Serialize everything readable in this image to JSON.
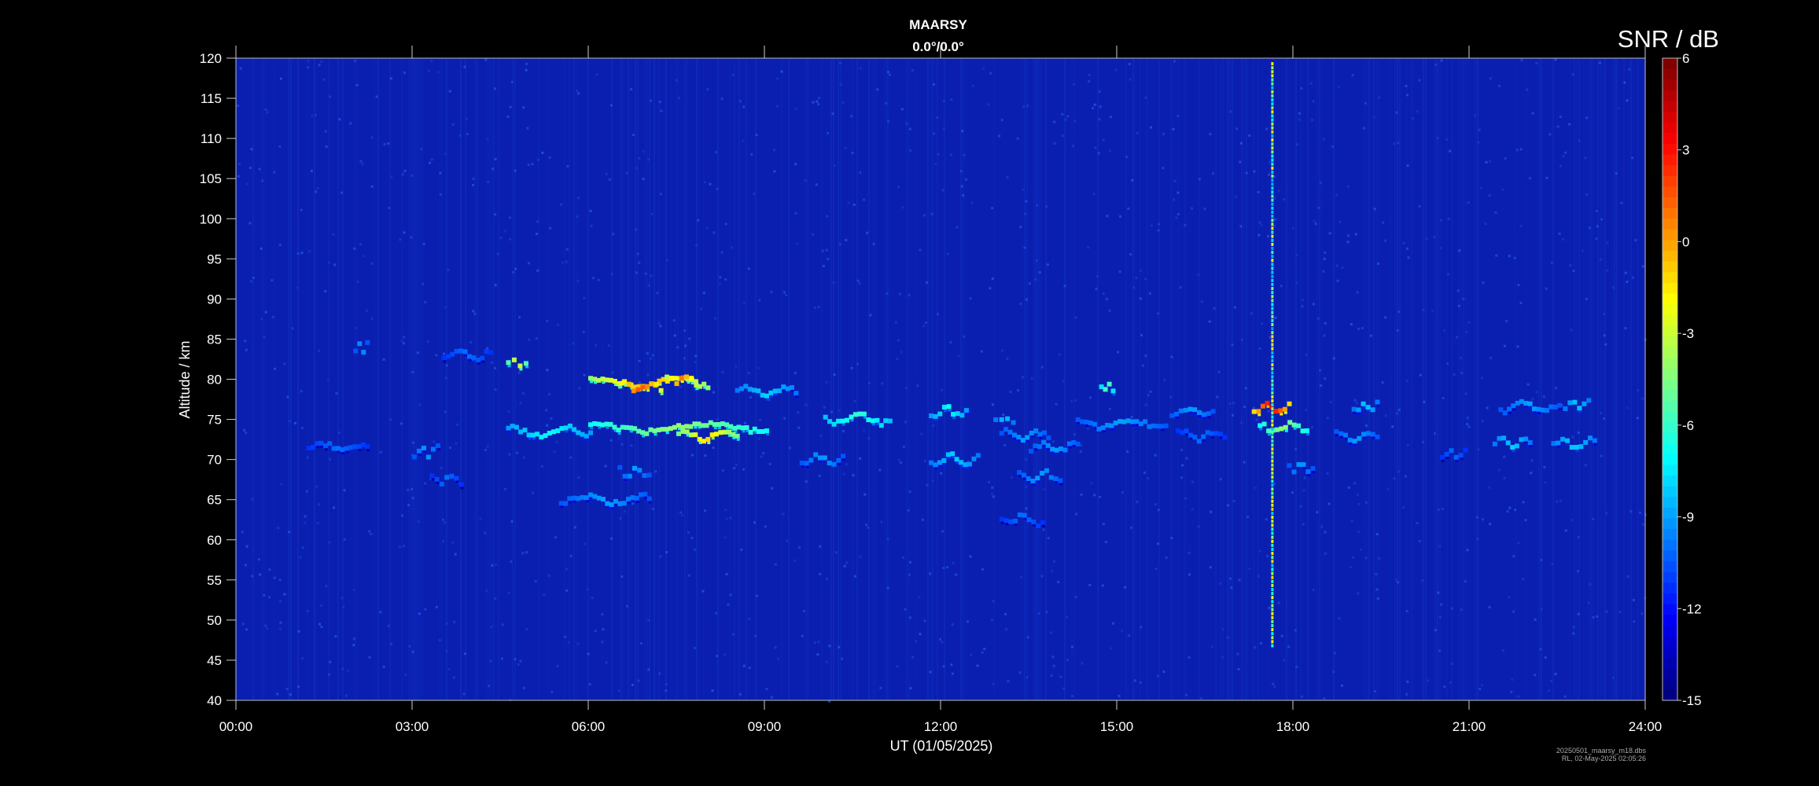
{
  "chart_data": {
    "type": "heatmap",
    "title": "MAARSY",
    "subtitle": "0.0°/0.0°",
    "xlabel": "UT (01/05/2025)",
    "ylabel": "Altitude / km",
    "colorbar_label": "SNR / dB",
    "x_ticks": [
      "00:00",
      "03:00",
      "06:00",
      "09:00",
      "12:00",
      "15:00",
      "18:00",
      "21:00",
      "24:00"
    ],
    "x_range_hours": [
      0,
      24
    ],
    "y_ticks": [
      40,
      45,
      50,
      55,
      60,
      65,
      70,
      75,
      80,
      85,
      90,
      95,
      100,
      105,
      110,
      115,
      120
    ],
    "ylim": [
      40,
      120
    ],
    "colorbar_ticks": [
      6,
      3,
      0,
      -3,
      -6,
      -9,
      -12,
      -15
    ],
    "clim": [
      -15,
      6
    ],
    "colormap": "jet",
    "background_color": "#0a1fb0",
    "features": [
      {
        "t_start": 1.2,
        "t_end": 2.2,
        "alt": 71.5,
        "snr": -10
      },
      {
        "t_start": 3.0,
        "t_end": 3.4,
        "alt": 71,
        "snr": -9
      },
      {
        "t_start": 3.3,
        "t_end": 3.8,
        "alt": 67.5,
        "snr": -10
      },
      {
        "t_start": 2.0,
        "t_end": 2.2,
        "alt": 84,
        "snr": -9
      },
      {
        "t_start": 3.5,
        "t_end": 4.3,
        "alt": 83,
        "snr": -10
      },
      {
        "t_start": 4.6,
        "t_end": 4.9,
        "alt": 82,
        "snr": -2
      },
      {
        "t_start": 4.6,
        "t_end": 6.0,
        "alt": 73.5,
        "snr": -7
      },
      {
        "t_start": 5.5,
        "t_end": 7.0,
        "alt": 65,
        "snr": -9
      },
      {
        "t_start": 6.0,
        "t_end": 8.0,
        "alt": 79.5,
        "snr": 0
      },
      {
        "t_start": 6.5,
        "t_end": 7.2,
        "alt": 79,
        "snr": 2
      },
      {
        "t_start": 7.3,
        "t_end": 7.8,
        "alt": 80,
        "snr": 1
      },
      {
        "t_start": 6.0,
        "t_end": 9.0,
        "alt": 74,
        "snr": -4
      },
      {
        "t_start": 7.5,
        "t_end": 8.5,
        "alt": 73,
        "snr": -1
      },
      {
        "t_start": 6.5,
        "t_end": 7.0,
        "alt": 68.5,
        "snr": -9
      },
      {
        "t_start": 8.5,
        "t_end": 9.5,
        "alt": 78.5,
        "snr": -8
      },
      {
        "t_start": 9.6,
        "t_end": 10.3,
        "alt": 70,
        "snr": -9
      },
      {
        "t_start": 10.0,
        "t_end": 11.1,
        "alt": 75,
        "snr": -6
      },
      {
        "t_start": 11.8,
        "t_end": 12.6,
        "alt": 70,
        "snr": -8
      },
      {
        "t_start": 11.8,
        "t_end": 12.4,
        "alt": 76,
        "snr": -7
      },
      {
        "t_start": 12.9,
        "t_end": 13.2,
        "alt": 75,
        "snr": -8
      },
      {
        "t_start": 13.0,
        "t_end": 13.8,
        "alt": 73,
        "snr": -9
      },
      {
        "t_start": 13.3,
        "t_end": 14.0,
        "alt": 68,
        "snr": -9
      },
      {
        "t_start": 13.0,
        "t_end": 13.7,
        "alt": 62.5,
        "snr": -10
      },
      {
        "t_start": 13.5,
        "t_end": 14.3,
        "alt": 71.5,
        "snr": -9
      },
      {
        "t_start": 14.3,
        "t_end": 15.8,
        "alt": 74.5,
        "snr": -9
      },
      {
        "t_start": 14.7,
        "t_end": 14.9,
        "alt": 79,
        "snr": -5
      },
      {
        "t_start": 15.9,
        "t_end": 16.6,
        "alt": 76,
        "snr": -9
      },
      {
        "t_start": 16.0,
        "t_end": 16.8,
        "alt": 73,
        "snr": -10
      },
      {
        "t_start": 17.3,
        "t_end": 17.9,
        "alt": 76.5,
        "snr": 4
      },
      {
        "t_start": 17.4,
        "t_end": 18.2,
        "alt": 74,
        "snr": -4
      },
      {
        "t_start": 17.9,
        "t_end": 18.3,
        "alt": 69,
        "snr": -9
      },
      {
        "t_start": 18.7,
        "t_end": 19.4,
        "alt": 73,
        "snr": -9
      },
      {
        "t_start": 19.0,
        "t_end": 19.4,
        "alt": 76.5,
        "snr": -8
      },
      {
        "t_start": 20.5,
        "t_end": 20.9,
        "alt": 70.5,
        "snr": -10
      },
      {
        "t_start": 21.5,
        "t_end": 22.5,
        "alt": 76.5,
        "snr": -9
      },
      {
        "t_start": 21.4,
        "t_end": 22.0,
        "alt": 72,
        "snr": -8
      },
      {
        "t_start": 22.4,
        "t_end": 23.1,
        "alt": 72,
        "snr": -8
      },
      {
        "t_start": 22.6,
        "t_end": 23.0,
        "alt": 77,
        "snr": -8
      }
    ],
    "vertical_streak": {
      "t": 17.65,
      "alt_min": 47,
      "alt_max": 120,
      "snr": -3
    }
  },
  "footnote": {
    "line1": "20250501_maarsy_m18.dbs",
    "line2": "RL, 02-May-2025 02:05:26"
  }
}
